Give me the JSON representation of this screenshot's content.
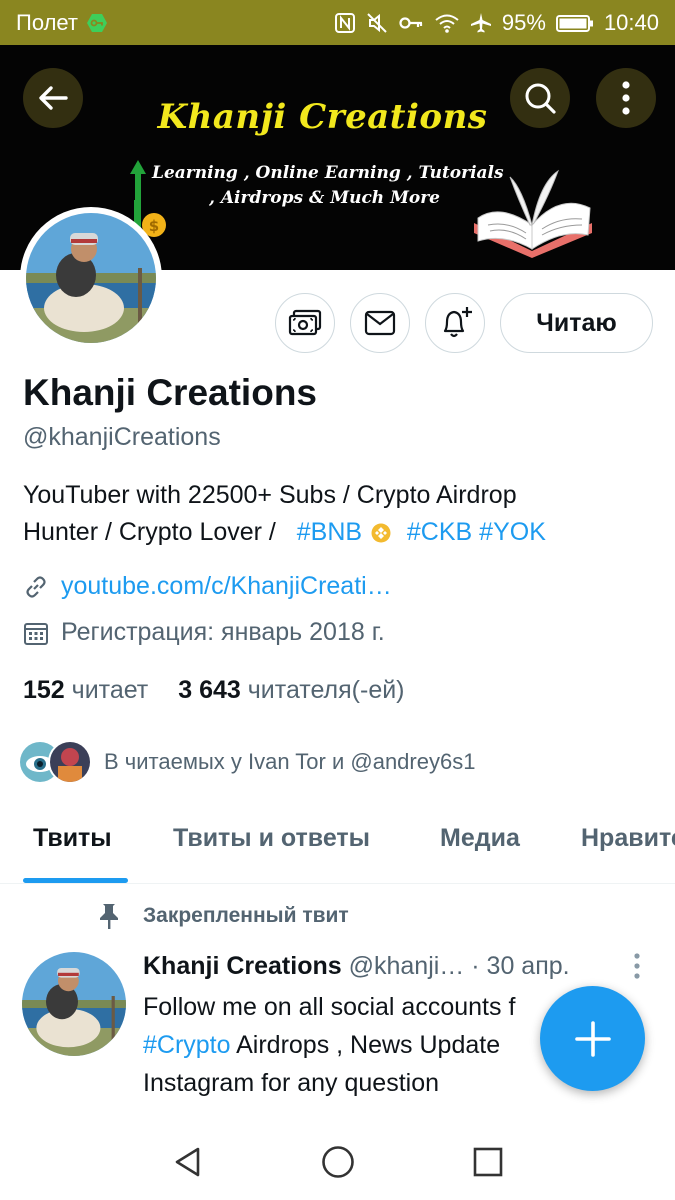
{
  "status_bar": {
    "carrier": "Полет",
    "battery_percent": "95%",
    "time": "10:40",
    "icons": [
      "vpn-key-icon",
      "nfc-icon",
      "mute-icon",
      "key-icon",
      "wifi-icon",
      "airplane-icon",
      "battery-icon"
    ]
  },
  "header": {
    "back_icon": "arrow-left-icon",
    "search_icon": "search-icon",
    "more_icon": "more-vertical-icon"
  },
  "banner": {
    "title": "Khanji Creations",
    "line1": "Learning , Online Earning , Tutorials",
    "line2": ", Airdrops & Much More",
    "colors": {
      "background": "#040404",
      "title": "#f2e81d"
    }
  },
  "profile": {
    "actions": {
      "tips_icon": "money-icon",
      "message_icon": "mail-icon",
      "notify_icon": "bell-plus-icon",
      "follow_label": "Читаю"
    },
    "name": "Khanji Creations",
    "handle": "@khanjiCreations",
    "bio": {
      "text1": "YouTuber with 22500+ Subs / Crypto Airdrop",
      "text2": "Hunter / Crypto Lover /",
      "hashtag_bnb": "#BNB",
      "hashtag_ckb": "#CKB",
      "hashtag_yok": "#YOK"
    },
    "website": "youtube.com/c/KhanjiCreati…",
    "joined": "Регистрация: январь 2018 г.",
    "following_count": "152",
    "following_label": "читает",
    "followers_count": "3 643",
    "followers_label": "читателя(-ей)",
    "mutual_text": "В читаемых у Ivan Tor и @andrey6s1"
  },
  "tabs": [
    {
      "label": "Твиты",
      "active": true
    },
    {
      "label": "Твиты и ответы",
      "active": false
    },
    {
      "label": "Медиа",
      "active": false
    },
    {
      "label": "Нравится",
      "active": false
    }
  ],
  "pinned_tweet": {
    "pinned_label": "Закрепленный твит",
    "author_name": "Khanji Creations",
    "author_handle": "@khanji…",
    "date": "· 30 апр.",
    "line1": "Follow me on all social accounts f",
    "line2_hashtag": "#Crypto",
    "line2_rest": " Airdrops , News Update",
    "line3": "Instagram for any question"
  },
  "fab": {
    "icon": "plus-icon",
    "color": "#1d9bf0"
  },
  "nav_bar": {
    "back_icon": "triangle-back-icon",
    "home_icon": "circle-home-icon",
    "recents_icon": "square-recents-icon"
  },
  "colors": {
    "accent": "#1d9bf0",
    "status_bar": "#8a8620",
    "secondary_text": "#536471"
  }
}
